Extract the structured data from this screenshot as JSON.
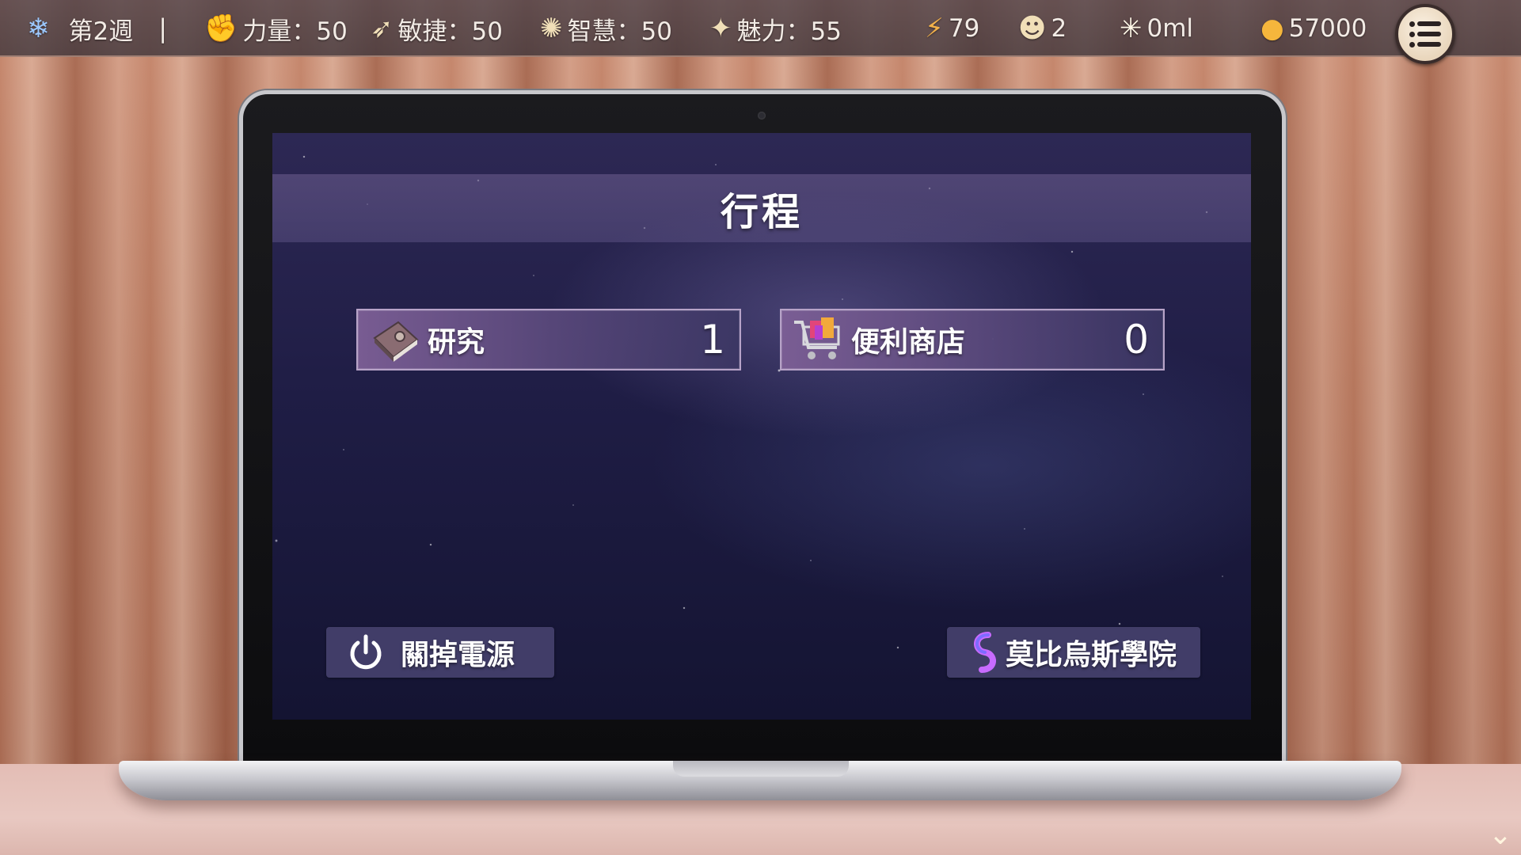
{
  "hud": {
    "season_icon": "snowflake-icon",
    "week": "第2週",
    "separator": "|",
    "strength": "力量：50",
    "agility": "敏捷：50",
    "wisdom": "智慧：50",
    "charm": "魅力：55",
    "energy": "79",
    "followers": "2",
    "liquid": "0ml",
    "money": "57000"
  },
  "screen": {
    "title": "行程",
    "schedule_items": [
      {
        "icon": "book-icon",
        "label": "研究",
        "count": "1"
      },
      {
        "icon": "shopping-cart-icon",
        "label": "便利商店",
        "count": "0"
      }
    ],
    "power_button": "關掉電源",
    "academy_button": "莫比烏斯學院"
  },
  "colors": {
    "hud_bar": "#564a4f",
    "screen_bg": "#1f1d45",
    "schedule_item": "#7d5f96",
    "bottom_button": "#46416e"
  }
}
